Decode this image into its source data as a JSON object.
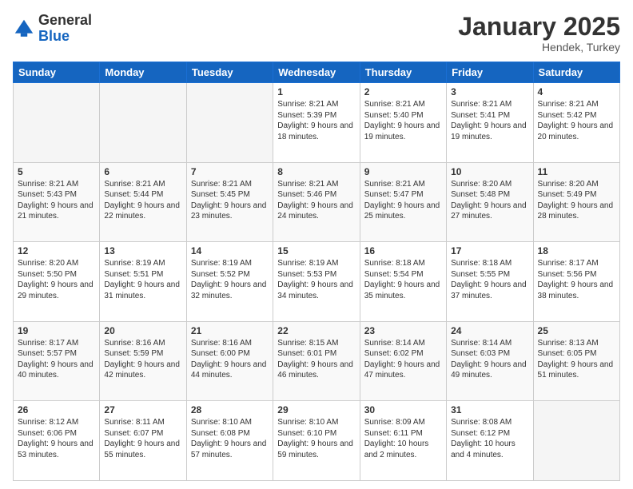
{
  "header": {
    "logo_general": "General",
    "logo_blue": "Blue",
    "month_title": "January 2025",
    "location": "Hendek, Turkey"
  },
  "days_of_week": [
    "Sunday",
    "Monday",
    "Tuesday",
    "Wednesday",
    "Thursday",
    "Friday",
    "Saturday"
  ],
  "weeks": [
    [
      {
        "day": "",
        "info": ""
      },
      {
        "day": "",
        "info": ""
      },
      {
        "day": "",
        "info": ""
      },
      {
        "day": "1",
        "info": "Sunrise: 8:21 AM\nSunset: 5:39 PM\nDaylight: 9 hours\nand 18 minutes."
      },
      {
        "day": "2",
        "info": "Sunrise: 8:21 AM\nSunset: 5:40 PM\nDaylight: 9 hours\nand 19 minutes."
      },
      {
        "day": "3",
        "info": "Sunrise: 8:21 AM\nSunset: 5:41 PM\nDaylight: 9 hours\nand 19 minutes."
      },
      {
        "day": "4",
        "info": "Sunrise: 8:21 AM\nSunset: 5:42 PM\nDaylight: 9 hours\nand 20 minutes."
      }
    ],
    [
      {
        "day": "5",
        "info": "Sunrise: 8:21 AM\nSunset: 5:43 PM\nDaylight: 9 hours\nand 21 minutes."
      },
      {
        "day": "6",
        "info": "Sunrise: 8:21 AM\nSunset: 5:44 PM\nDaylight: 9 hours\nand 22 minutes."
      },
      {
        "day": "7",
        "info": "Sunrise: 8:21 AM\nSunset: 5:45 PM\nDaylight: 9 hours\nand 23 minutes."
      },
      {
        "day": "8",
        "info": "Sunrise: 8:21 AM\nSunset: 5:46 PM\nDaylight: 9 hours\nand 24 minutes."
      },
      {
        "day": "9",
        "info": "Sunrise: 8:21 AM\nSunset: 5:47 PM\nDaylight: 9 hours\nand 25 minutes."
      },
      {
        "day": "10",
        "info": "Sunrise: 8:20 AM\nSunset: 5:48 PM\nDaylight: 9 hours\nand 27 minutes."
      },
      {
        "day": "11",
        "info": "Sunrise: 8:20 AM\nSunset: 5:49 PM\nDaylight: 9 hours\nand 28 minutes."
      }
    ],
    [
      {
        "day": "12",
        "info": "Sunrise: 8:20 AM\nSunset: 5:50 PM\nDaylight: 9 hours\nand 29 minutes."
      },
      {
        "day": "13",
        "info": "Sunrise: 8:19 AM\nSunset: 5:51 PM\nDaylight: 9 hours\nand 31 minutes."
      },
      {
        "day": "14",
        "info": "Sunrise: 8:19 AM\nSunset: 5:52 PM\nDaylight: 9 hours\nand 32 minutes."
      },
      {
        "day": "15",
        "info": "Sunrise: 8:19 AM\nSunset: 5:53 PM\nDaylight: 9 hours\nand 34 minutes."
      },
      {
        "day": "16",
        "info": "Sunrise: 8:18 AM\nSunset: 5:54 PM\nDaylight: 9 hours\nand 35 minutes."
      },
      {
        "day": "17",
        "info": "Sunrise: 8:18 AM\nSunset: 5:55 PM\nDaylight: 9 hours\nand 37 minutes."
      },
      {
        "day": "18",
        "info": "Sunrise: 8:17 AM\nSunset: 5:56 PM\nDaylight: 9 hours\nand 38 minutes."
      }
    ],
    [
      {
        "day": "19",
        "info": "Sunrise: 8:17 AM\nSunset: 5:57 PM\nDaylight: 9 hours\nand 40 minutes."
      },
      {
        "day": "20",
        "info": "Sunrise: 8:16 AM\nSunset: 5:59 PM\nDaylight: 9 hours\nand 42 minutes."
      },
      {
        "day": "21",
        "info": "Sunrise: 8:16 AM\nSunset: 6:00 PM\nDaylight: 9 hours\nand 44 minutes."
      },
      {
        "day": "22",
        "info": "Sunrise: 8:15 AM\nSunset: 6:01 PM\nDaylight: 9 hours\nand 46 minutes."
      },
      {
        "day": "23",
        "info": "Sunrise: 8:14 AM\nSunset: 6:02 PM\nDaylight: 9 hours\nand 47 minutes."
      },
      {
        "day": "24",
        "info": "Sunrise: 8:14 AM\nSunset: 6:03 PM\nDaylight: 9 hours\nand 49 minutes."
      },
      {
        "day": "25",
        "info": "Sunrise: 8:13 AM\nSunset: 6:05 PM\nDaylight: 9 hours\nand 51 minutes."
      }
    ],
    [
      {
        "day": "26",
        "info": "Sunrise: 8:12 AM\nSunset: 6:06 PM\nDaylight: 9 hours\nand 53 minutes."
      },
      {
        "day": "27",
        "info": "Sunrise: 8:11 AM\nSunset: 6:07 PM\nDaylight: 9 hours\nand 55 minutes."
      },
      {
        "day": "28",
        "info": "Sunrise: 8:10 AM\nSunset: 6:08 PM\nDaylight: 9 hours\nand 57 minutes."
      },
      {
        "day": "29",
        "info": "Sunrise: 8:10 AM\nSunset: 6:10 PM\nDaylight: 9 hours\nand 59 minutes."
      },
      {
        "day": "30",
        "info": "Sunrise: 8:09 AM\nSunset: 6:11 PM\nDaylight: 10 hours\nand 2 minutes."
      },
      {
        "day": "31",
        "info": "Sunrise: 8:08 AM\nSunset: 6:12 PM\nDaylight: 10 hours\nand 4 minutes."
      },
      {
        "day": "",
        "info": ""
      }
    ]
  ]
}
